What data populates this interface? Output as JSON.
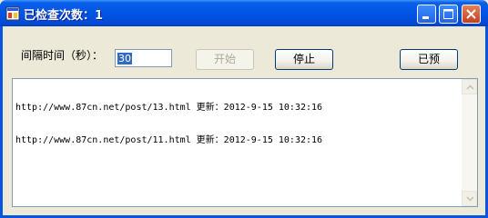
{
  "window": {
    "title": "已检查次数：1"
  },
  "form": {
    "interval_label": "间隔时间（秒）：",
    "interval_value": "30",
    "start_label": "开始",
    "stop_label": "停止",
    "done_label": "已预"
  },
  "log": {
    "lines": [
      "http://www.87cn.net/post/13.html 更新：2012-9-15 10:32:16",
      "http://www.87cn.net/post/11.html 更新：2012-9-15 10:32:16"
    ]
  },
  "colors": {
    "titlebar": "#0055e5",
    "selection": "#316ac5",
    "close_button": "#c4411c"
  }
}
